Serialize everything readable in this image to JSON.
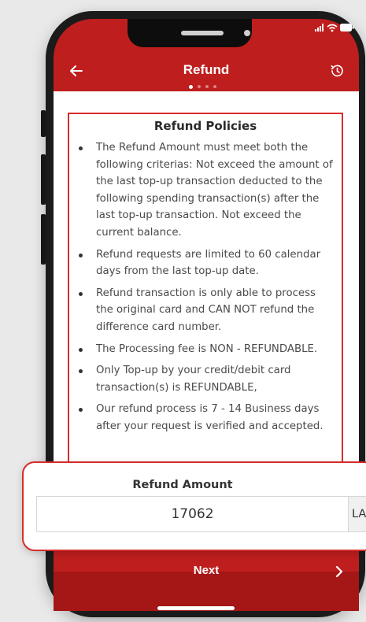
{
  "header": {
    "title": "Refund",
    "page_indicator": {
      "total": 4,
      "active": 1
    }
  },
  "policies": {
    "title": "Refund Policies",
    "items": [
      "The Refund Amount must meet both the following criterias: Not exceed the amount of the last top-up transaction deducted to the following spending transaction(s) after the last top-up transaction. Not exceed the current balance.",
      "Refund requests are limited to 60 calendar days from the last top-up date.",
      "Refund transaction is only able to process the original card and CAN NOT refund the difference card number.",
      "The Processing fee is NON - REFUNDABLE.",
      "Only Top-up by your credit/debit card transaction(s) is REFUNDABLE,",
      "Our refund process is 7 - 14 Business days after your request is verified and accepted."
    ]
  },
  "amount": {
    "label": "Refund Amount",
    "value": "17062",
    "currency": "LAK"
  },
  "footer": {
    "next_label": "Next"
  },
  "colors": {
    "brand_red": "#bf1e1e",
    "highlight_border": "#d92c2c"
  },
  "icons": {
    "back": "arrow-left-icon",
    "history": "history-icon",
    "next": "chevron-right-icon",
    "status": [
      "signal-icon",
      "wifi-icon",
      "battery-icon"
    ]
  }
}
